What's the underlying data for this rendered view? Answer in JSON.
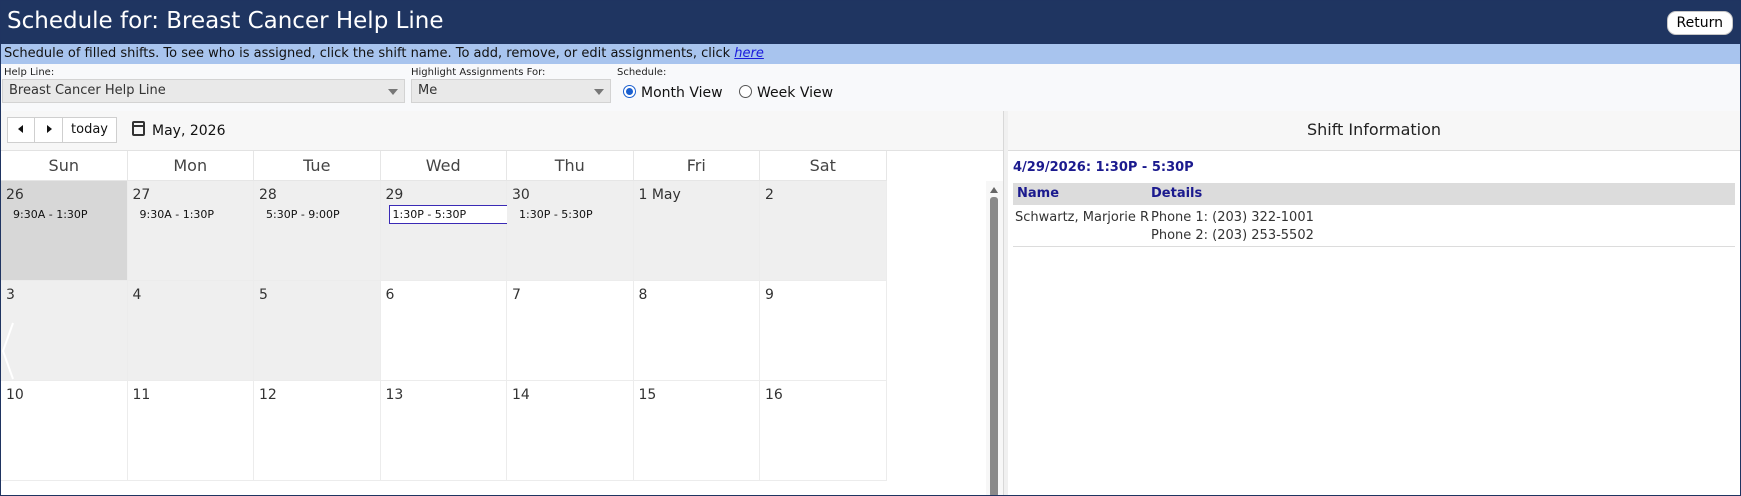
{
  "header": {
    "title": "Schedule for: Breast Cancer Help Line",
    "return_label": "Return"
  },
  "infobar": {
    "text": "Schedule of filled shifts. To see who is assigned, click the shift name.   To add, remove, or edit assignments, click ",
    "link_text": "here"
  },
  "filters": {
    "help_line_label": "Help Line:",
    "help_line_value": "Breast Cancer Help Line",
    "highlight_label": "Highlight Assignments For:",
    "highlight_value": "Me",
    "schedule_label": "Schedule:",
    "views": [
      {
        "label": "Month View",
        "selected": true
      },
      {
        "label": "Week View",
        "selected": false
      }
    ]
  },
  "calendar": {
    "today_label": "today",
    "month_label": "May, 2026",
    "weekdays": [
      "Sun",
      "Mon",
      "Tue",
      "Wed",
      "Thu",
      "Fri",
      "Sat"
    ],
    "weeks": [
      [
        {
          "day": "26",
          "other": true,
          "first": true,
          "shift": "9:30A - 1:30P",
          "selected": false
        },
        {
          "day": "27",
          "other": true,
          "shift": "9:30A - 1:30P",
          "selected": false
        },
        {
          "day": "28",
          "other": true,
          "shift": "5:30P - 9:00P",
          "selected": false
        },
        {
          "day": "29",
          "other": true,
          "shift": "1:30P - 5:30P",
          "selected": true
        },
        {
          "day": "30",
          "other": true,
          "shift": "1:30P - 5:30P",
          "selected": false
        },
        {
          "day": "1 May",
          "other": true,
          "shift": "",
          "selected": false
        },
        {
          "day": "2",
          "other": true,
          "shift": "",
          "selected": false
        }
      ],
      [
        {
          "day": "3",
          "other": true,
          "shift": ""
        },
        {
          "day": "4",
          "other": true,
          "shift": ""
        },
        {
          "day": "5",
          "other": true,
          "shift": ""
        },
        {
          "day": "6",
          "other": false,
          "shift": ""
        },
        {
          "day": "7",
          "other": false,
          "shift": ""
        },
        {
          "day": "8",
          "other": false,
          "shift": ""
        },
        {
          "day": "9",
          "other": false,
          "shift": ""
        }
      ],
      [
        {
          "day": "10",
          "other": false,
          "shift": ""
        },
        {
          "day": "11",
          "other": false,
          "shift": ""
        },
        {
          "day": "12",
          "other": false,
          "shift": ""
        },
        {
          "day": "13",
          "other": false,
          "shift": ""
        },
        {
          "day": "14",
          "other": false,
          "shift": ""
        },
        {
          "day": "15",
          "other": false,
          "shift": ""
        },
        {
          "day": "16",
          "other": false,
          "shift": ""
        }
      ]
    ]
  },
  "shift_info": {
    "heading": "Shift Information",
    "shift_title": "4/29/2026: 1:30P - 5:30P",
    "columns": [
      "Name",
      "Details"
    ],
    "rows": [
      {
        "name": "Schwartz, Marjorie R",
        "phone1": "Phone 1: (203) 322-1001",
        "phone2": "Phone 2: (203) 253-5502"
      }
    ]
  },
  "colors": {
    "header_bg": "#1f3561",
    "infobar_bg": "#a8c4ee",
    "accent_text": "#1b1a8e",
    "selected_shift_border": "#3a2ab5"
  }
}
